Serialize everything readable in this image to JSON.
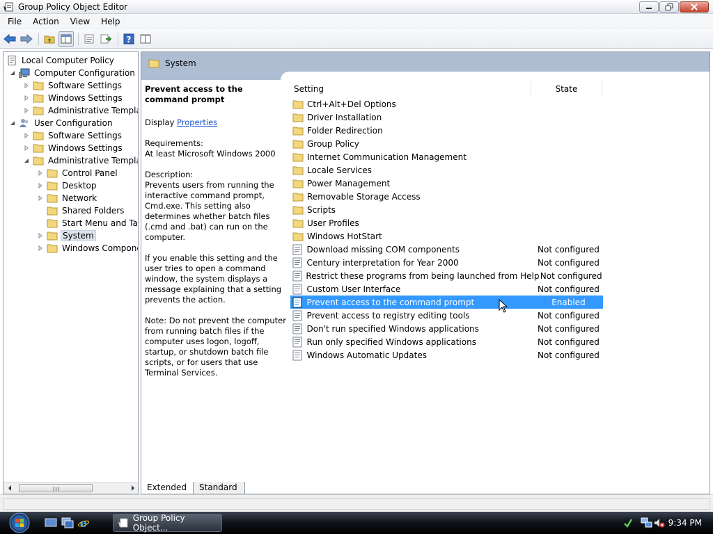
{
  "window": {
    "title": "Group Policy Object Editor"
  },
  "menu": [
    "File",
    "Action",
    "View",
    "Help"
  ],
  "toolbar": {
    "icons": [
      "back-arrow-icon",
      "forward-arrow-icon",
      "up-folder-icon",
      "show-hide-tree-icon",
      "export-list-icon",
      "properties-icon",
      "help-icon",
      "extended-view-icon"
    ]
  },
  "tree": [
    {
      "label": "Local Computer Policy",
      "icon": "policy-doc-icon",
      "level": 0,
      "expander": "none"
    },
    {
      "label": "Computer Configuration",
      "icon": "computer-icon",
      "level": 1,
      "expander": "expanded"
    },
    {
      "label": "Software Settings",
      "icon": "folder-icon",
      "level": 2,
      "expander": "collapsed"
    },
    {
      "label": "Windows Settings",
      "icon": "folder-icon",
      "level": 2,
      "expander": "collapsed"
    },
    {
      "label": "Administrative Templates",
      "icon": "folder-icon",
      "level": 2,
      "expander": "collapsed"
    },
    {
      "label": "User Configuration",
      "icon": "users-icon",
      "level": 1,
      "expander": "expanded"
    },
    {
      "label": "Software Settings",
      "icon": "folder-icon",
      "level": 2,
      "expander": "collapsed"
    },
    {
      "label": "Windows Settings",
      "icon": "folder-icon",
      "level": 2,
      "expander": "collapsed"
    },
    {
      "label": "Administrative Templates",
      "icon": "folder-icon",
      "level": 2,
      "expander": "expanded"
    },
    {
      "label": "Control Panel",
      "icon": "folder-icon",
      "level": 3,
      "expander": "collapsed"
    },
    {
      "label": "Desktop",
      "icon": "folder-icon",
      "level": 3,
      "expander": "collapsed"
    },
    {
      "label": "Network",
      "icon": "folder-icon",
      "level": 3,
      "expander": "collapsed"
    },
    {
      "label": "Shared Folders",
      "icon": "folder-icon",
      "level": 3,
      "expander": "none"
    },
    {
      "label": "Start Menu and Taskbar",
      "icon": "folder-icon",
      "level": 3,
      "expander": "none"
    },
    {
      "label": "System",
      "icon": "folder-icon",
      "level": 3,
      "expander": "collapsed",
      "selected": true
    },
    {
      "label": "Windows Components",
      "icon": "folder-icon",
      "level": 3,
      "expander": "collapsed"
    }
  ],
  "tree_scrollbar": {
    "grip": "III"
  },
  "header": {
    "title": "System"
  },
  "description": {
    "title": "Prevent access to the command prompt",
    "display_label": "Display",
    "display_link": "Properties",
    "requirements_label": "Requirements:",
    "requirements": "At least Microsoft Windows 2000",
    "description_label": "Description:",
    "description": "Prevents users from running the interactive command prompt, Cmd.exe. This setting also determines whether batch files (.cmd and .bat) can run on the computer.",
    "enable_note": "If you enable this setting and the user tries to open a command window, the system displays a message explaining that a setting prevents the action.",
    "note": "Note: Do not prevent the computer from running batch files if the computer uses logon, logoff, startup, or shutdown batch file scripts, or for users that use Terminal Services."
  },
  "list": {
    "columns": [
      "Setting",
      "State"
    ],
    "rows": [
      {
        "name": "Ctrl+Alt+Del Options",
        "state": "",
        "type": "folder"
      },
      {
        "name": "Driver Installation",
        "state": "",
        "type": "folder"
      },
      {
        "name": "Folder Redirection",
        "state": "",
        "type": "folder"
      },
      {
        "name": "Group Policy",
        "state": "",
        "type": "folder"
      },
      {
        "name": "Internet Communication Management",
        "state": "",
        "type": "folder"
      },
      {
        "name": "Locale Services",
        "state": "",
        "type": "folder"
      },
      {
        "name": "Power Management",
        "state": "",
        "type": "folder"
      },
      {
        "name": "Removable Storage Access",
        "state": "",
        "type": "folder"
      },
      {
        "name": "Scripts",
        "state": "",
        "type": "folder"
      },
      {
        "name": "User Profiles",
        "state": "",
        "type": "folder"
      },
      {
        "name": "Windows HotStart",
        "state": "",
        "type": "folder"
      },
      {
        "name": "Download missing COM components",
        "state": "Not configured",
        "type": "setting"
      },
      {
        "name": "Century interpretation for Year 2000",
        "state": "Not configured",
        "type": "setting"
      },
      {
        "name": "Restrict these programs from being launched from Help",
        "state": "Not configured",
        "type": "setting"
      },
      {
        "name": "Custom User Interface",
        "state": "Not configured",
        "type": "setting"
      },
      {
        "name": "Prevent access to the command prompt",
        "state": "Enabled",
        "type": "setting",
        "selected": true
      },
      {
        "name": "Prevent access to registry editing tools",
        "state": "Not configured",
        "type": "setting"
      },
      {
        "name": "Don't run specified Windows applications",
        "state": "Not configured",
        "type": "setting"
      },
      {
        "name": "Run only specified Windows applications",
        "state": "Not configured",
        "type": "setting"
      },
      {
        "name": "Windows Automatic Updates",
        "state": "Not configured",
        "type": "setting"
      }
    ]
  },
  "tabs": [
    "Extended",
    "Standard"
  ],
  "taskbar": {
    "task_label": "Group Policy Object...",
    "clock": "9:34 PM",
    "quick_launch": [
      "show-desktop-icon",
      "switch-windows-icon",
      "internet-explorer-icon"
    ],
    "tray_icons": [
      "safely-remove-icon",
      "network-icon",
      "volume-muted-icon"
    ]
  },
  "colors": {
    "selection": "#3399ff",
    "header_band": "#aebdd2",
    "link": "#1a55c8"
  }
}
